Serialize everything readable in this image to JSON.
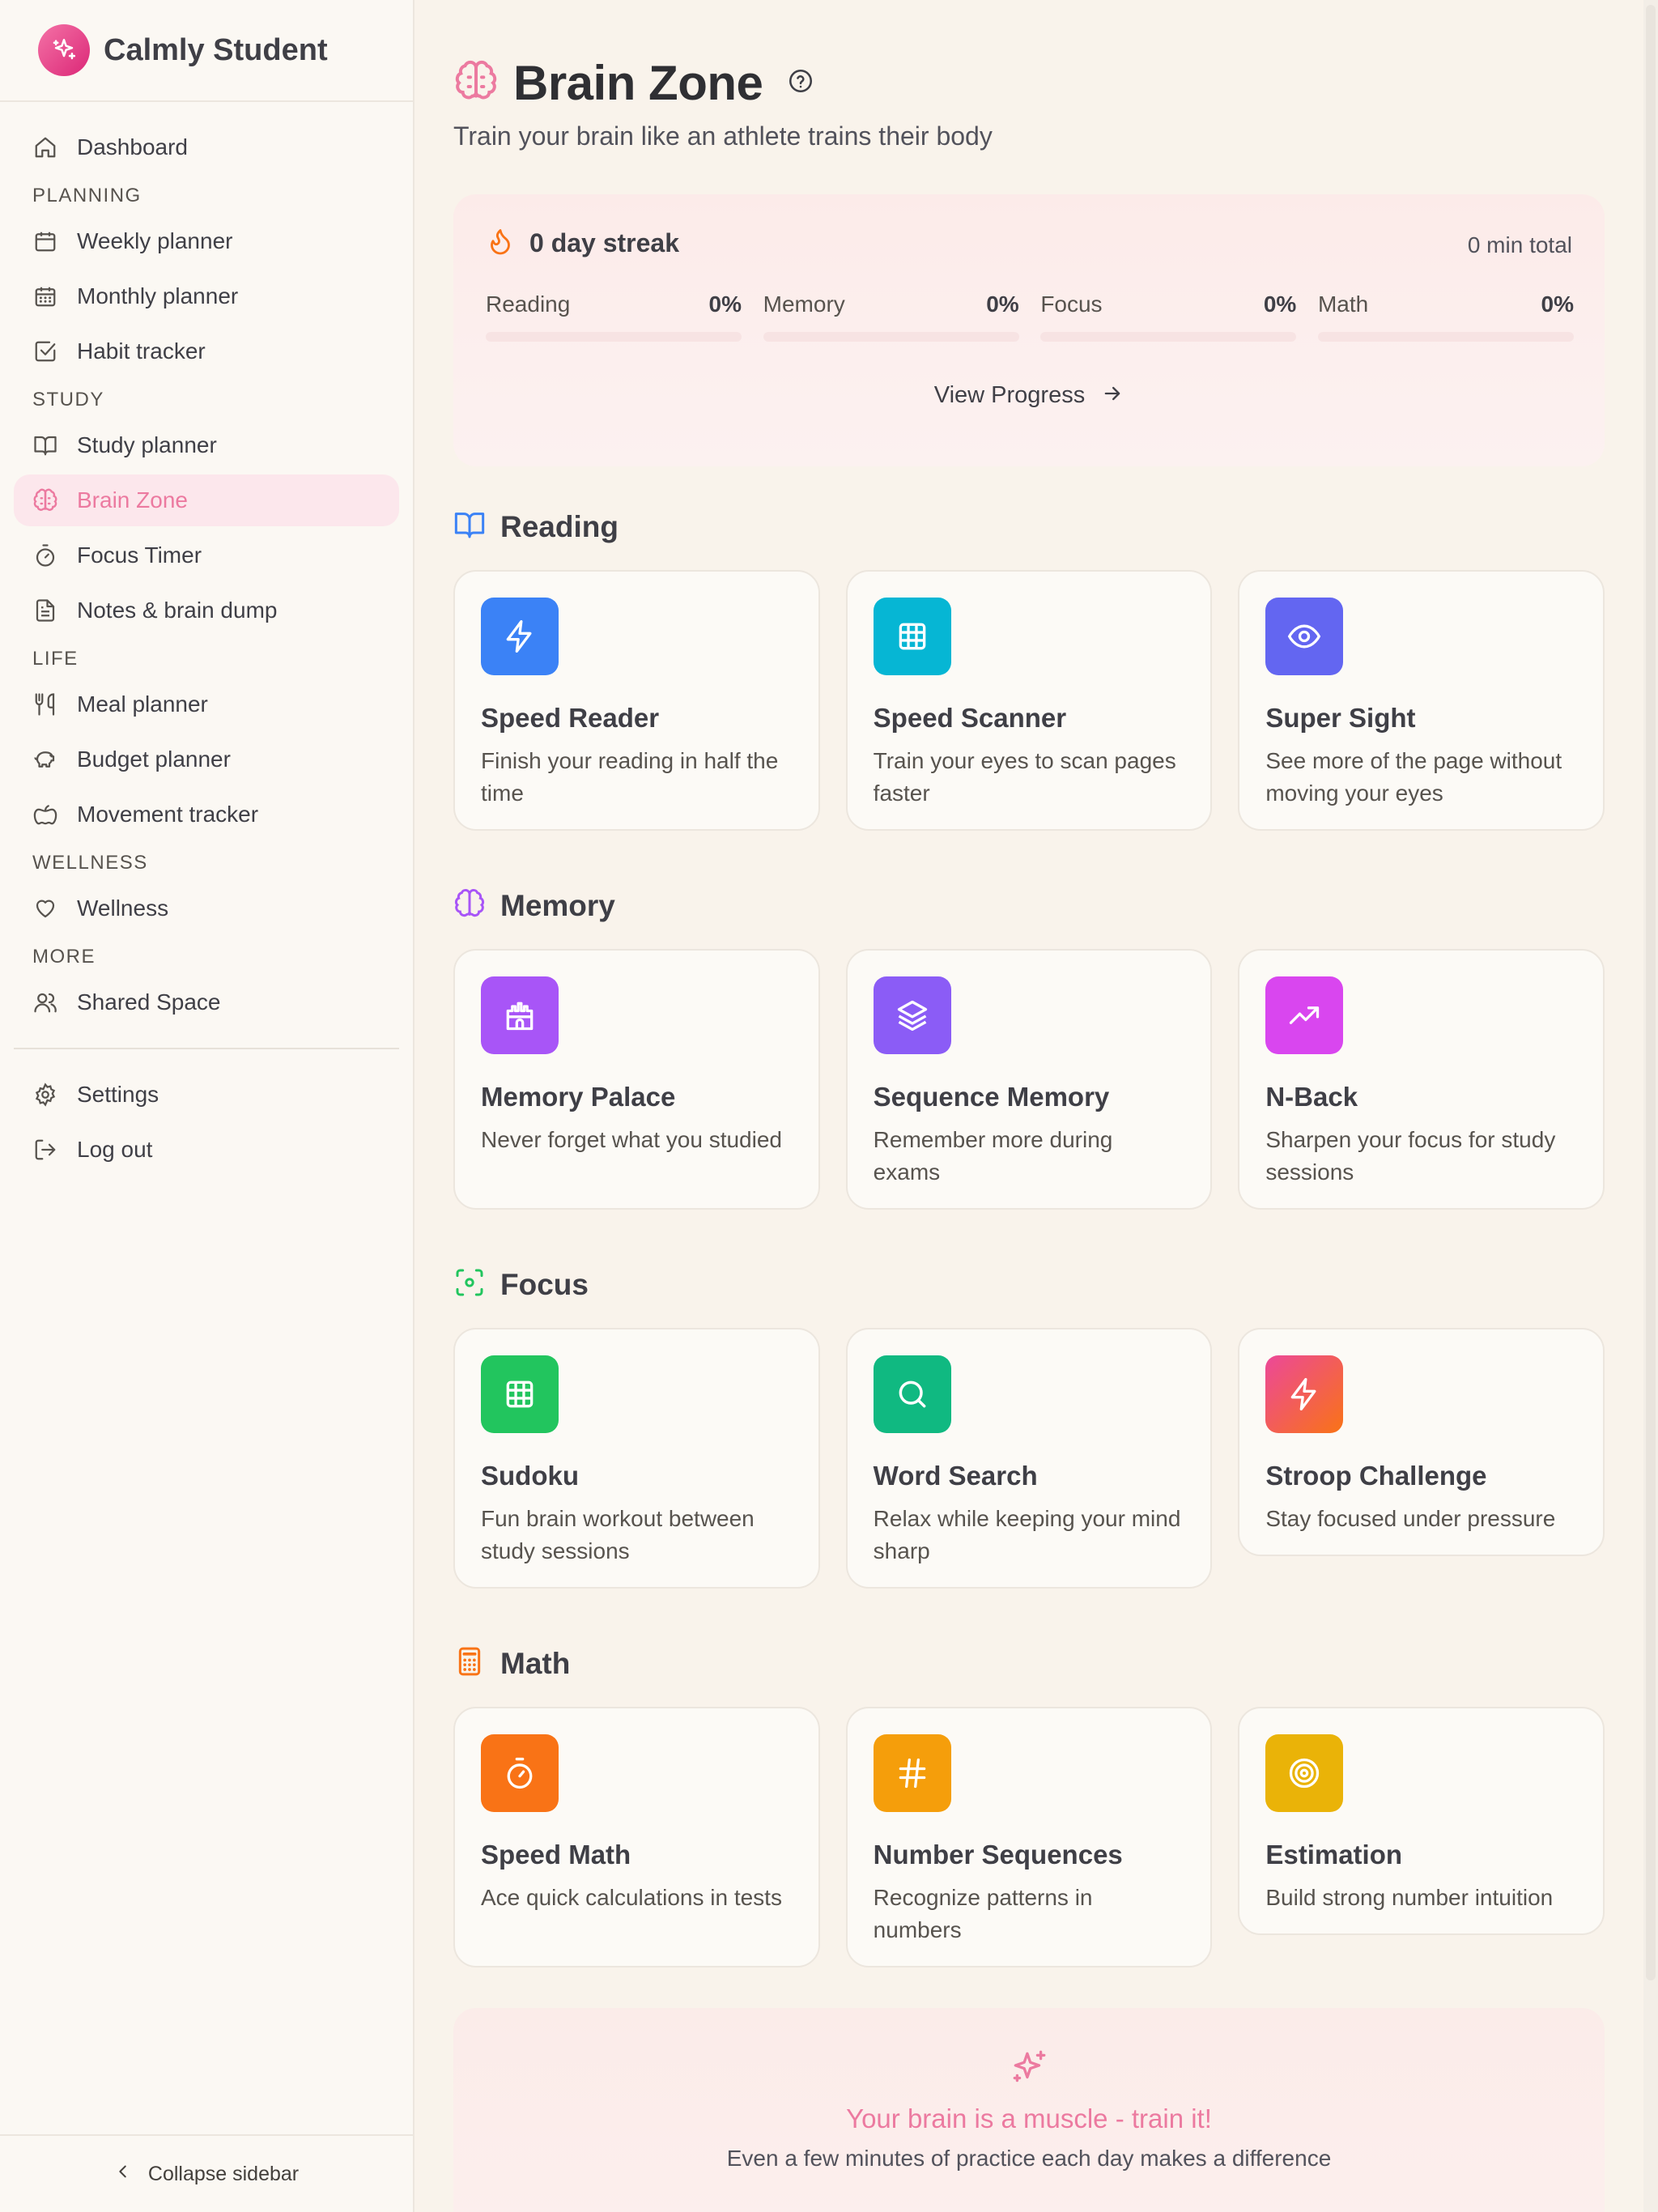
{
  "app": {
    "name": "Calmly Student"
  },
  "sidebar": {
    "dashboard": "Dashboard",
    "planning_header": "PLANNING",
    "weekly": "Weekly planner",
    "monthly": "Monthly planner",
    "habit": "Habit tracker",
    "study_header": "STUDY",
    "study_planner": "Study planner",
    "brain_zone": "Brain Zone",
    "focus_timer": "Focus Timer",
    "notes": "Notes & brain dump",
    "life_header": "LIFE",
    "meal": "Meal planner",
    "budget": "Budget planner",
    "movement": "Movement tracker",
    "wellness_header": "WELLNESS",
    "wellness": "Wellness",
    "more_header": "MORE",
    "shared": "Shared Space",
    "settings": "Settings",
    "logout": "Log out",
    "collapse": "Collapse sidebar"
  },
  "page": {
    "title": "Brain Zone",
    "subtitle": "Train your brain like an athlete trains their body"
  },
  "streak": {
    "label": "0 day streak",
    "total": "0 min total",
    "stats": [
      {
        "name": "Reading",
        "value": "0%",
        "progress": 0
      },
      {
        "name": "Memory",
        "value": "0%",
        "progress": 0
      },
      {
        "name": "Focus",
        "value": "0%",
        "progress": 0
      },
      {
        "name": "Math",
        "value": "0%",
        "progress": 0
      }
    ],
    "view_progress": "View Progress"
  },
  "sections": {
    "reading": {
      "title": "Reading",
      "cards": [
        {
          "title": "Speed Reader",
          "desc": "Finish your reading in half the time",
          "color": "#3b82f6",
          "icon": "zap-icon"
        },
        {
          "title": "Speed Scanner",
          "desc": "Train your eyes to scan pages faster",
          "color": "#06b6d4",
          "icon": "grid-icon"
        },
        {
          "title": "Super Sight",
          "desc": "See more of the page without moving your eyes",
          "color": "#6366f1",
          "icon": "eye-icon"
        }
      ]
    },
    "memory": {
      "title": "Memory",
      "cards": [
        {
          "title": "Memory Palace",
          "desc": "Never forget what you studied",
          "color": "#a855f7",
          "icon": "castle-icon"
        },
        {
          "title": "Sequence Memory",
          "desc": "Remember more during exams",
          "color": "#8b5cf6",
          "icon": "layers-icon"
        },
        {
          "title": "N-Back",
          "desc": "Sharpen your focus for study sessions",
          "color": "#d946ef",
          "icon": "trending-up-icon"
        }
      ]
    },
    "focus": {
      "title": "Focus",
      "cards": [
        {
          "title": "Sudoku",
          "desc": "Fun brain workout between study sessions",
          "color": "#22c55e",
          "icon": "grid-icon"
        },
        {
          "title": "Word Search",
          "desc": "Relax while keeping your mind sharp",
          "color": "#10b981",
          "icon": "search-icon"
        },
        {
          "title": "Stroop Challenge",
          "desc": "Stay focused under pressure",
          "color": "#f0496e",
          "icon": "zap-icon"
        }
      ]
    },
    "math": {
      "title": "Math",
      "cards": [
        {
          "title": "Speed Math",
          "desc": "Ace quick calculations in tests",
          "color": "#f97316",
          "icon": "timer-icon"
        },
        {
          "title": "Number Sequences",
          "desc": "Recognize patterns in numbers",
          "color": "#f59e0b",
          "icon": "hash-icon"
        },
        {
          "title": "Estimation",
          "desc": "Build strong number intuition",
          "color": "#eab308",
          "icon": "target-icon"
        }
      ]
    }
  },
  "footer": {
    "title": "Your brain is a muscle - train it!",
    "subtitle": "Even a few minutes of practice each day makes a difference"
  },
  "colors": {
    "accent": "#ec7aa0",
    "background": "#f9f3eb"
  }
}
